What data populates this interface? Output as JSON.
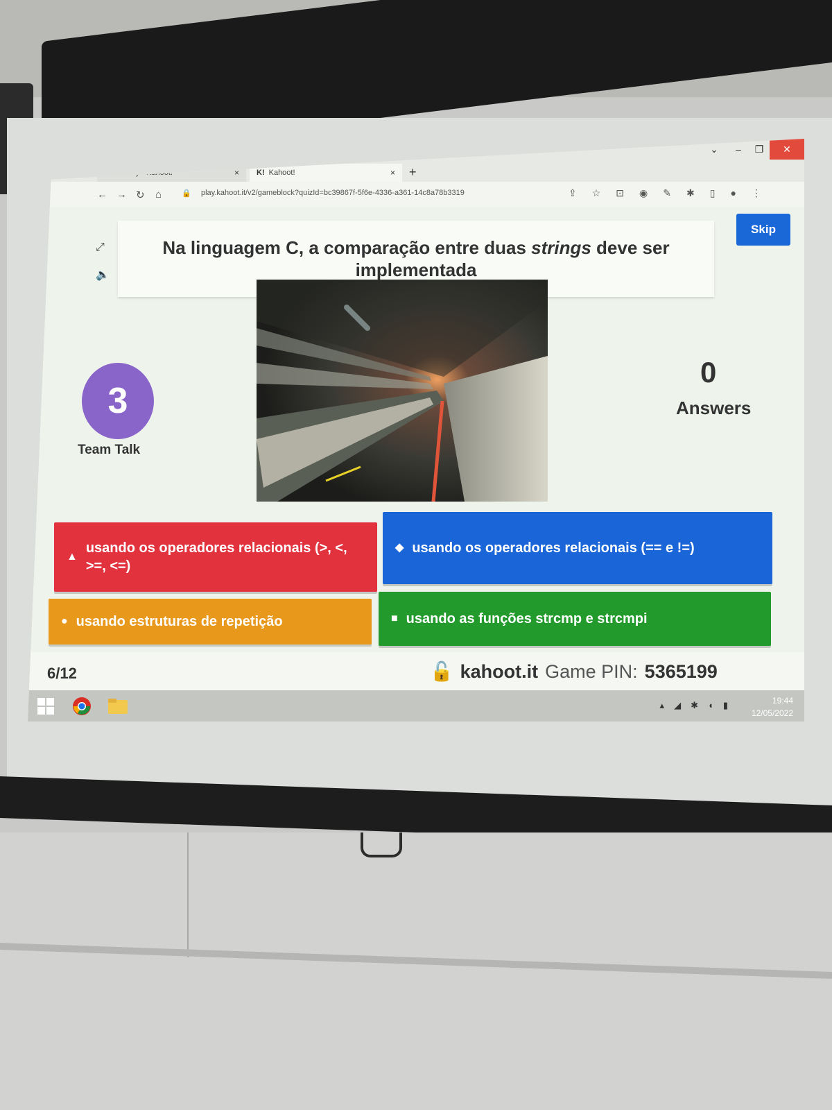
{
  "browser": {
    "tabs": [
      {
        "icon": "K!",
        "label": "Library - Kahoot!",
        "close": "×"
      },
      {
        "icon": "K!",
        "label": "Kahoot!",
        "close": "×"
      }
    ],
    "new_tab": "+",
    "url": "play.kahoot.it/v2/gameblock?quizId=bc39867f-5f6e-4336-a361-14c8a78b3319"
  },
  "game": {
    "question_prefix": "Na linguagem C, a comparação entre duas ",
    "question_em": "strings",
    "question_suffix": " deve ser implementada",
    "skip_label": "Skip",
    "timer_value": "3",
    "team_talk_label": "Team Talk",
    "answers_count": "0",
    "answers_label": "Answers",
    "answers": [
      {
        "shape": "▲",
        "text": "usando os operadores relacionais (>, <, >=, <=)",
        "color": "#e2323d"
      },
      {
        "shape": "◆",
        "text": "usando os operadores relacionais (== e !=)",
        "color": "#1a66d8"
      },
      {
        "shape": "●",
        "text": "usando estruturas de repetição",
        "color": "#e8981b"
      },
      {
        "shape": "■",
        "text": "usando as funções strcmp e strcmpi",
        "color": "#239b2c"
      }
    ]
  },
  "footer": {
    "question_counter": "6/12",
    "site": "kahoot.it",
    "pin_label": "Game PIN:",
    "pin_value": "5365199"
  },
  "taskbar": {
    "time": "19:44",
    "date": "12/05/2022"
  }
}
